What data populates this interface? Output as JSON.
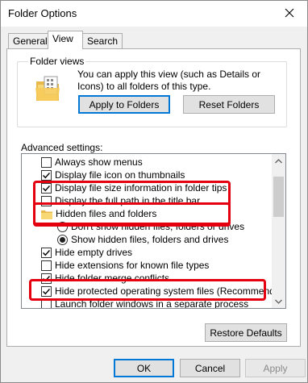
{
  "window": {
    "title": "Folder Options"
  },
  "tabs": [
    {
      "label": "General"
    },
    {
      "label": "View"
    },
    {
      "label": "Search"
    }
  ],
  "folder_views": {
    "label": "Folder views",
    "description": "You can apply this view (such as Details or Icons) to all folders of this type.",
    "apply_label": "Apply to Folders",
    "reset_label": "Reset Folders"
  },
  "advanced": {
    "label": "Advanced settings:",
    "items": [
      {
        "label": "Always show menus",
        "type": "checkbox",
        "checked": false
      },
      {
        "label": "Display file icon on thumbnails",
        "type": "checkbox",
        "checked": true
      },
      {
        "label": "Display file size information in folder tips",
        "type": "checkbox",
        "checked": true
      },
      {
        "label": "Display the full path in the title bar",
        "type": "checkbox",
        "checked": false
      },
      {
        "label": "Hidden files and folders",
        "type": "folder"
      },
      {
        "label": "Don't show hidden files, folders or drives",
        "type": "radio",
        "checked": false
      },
      {
        "label": "Show hidden files, folders and drives",
        "type": "radio",
        "checked": true
      },
      {
        "label": "Hide empty drives",
        "type": "checkbox",
        "checked": true
      },
      {
        "label": "Hide extensions for known file types",
        "type": "checkbox",
        "checked": false
      },
      {
        "label": "Hide folder merge conflicts",
        "type": "checkbox",
        "checked": true
      },
      {
        "label": "Hide protected operating system files (Recommended)",
        "type": "checkbox",
        "checked": true
      },
      {
        "label": "Launch folder windows in a separate process",
        "type": "checkbox",
        "checked": false
      }
    ]
  },
  "restore_label": "Restore Defaults",
  "footer": {
    "ok_label": "OK",
    "cancel_label": "Cancel",
    "apply_label": "Apply"
  },
  "colors": {
    "highlight": "#e4000f",
    "accent": "#0078d7"
  }
}
